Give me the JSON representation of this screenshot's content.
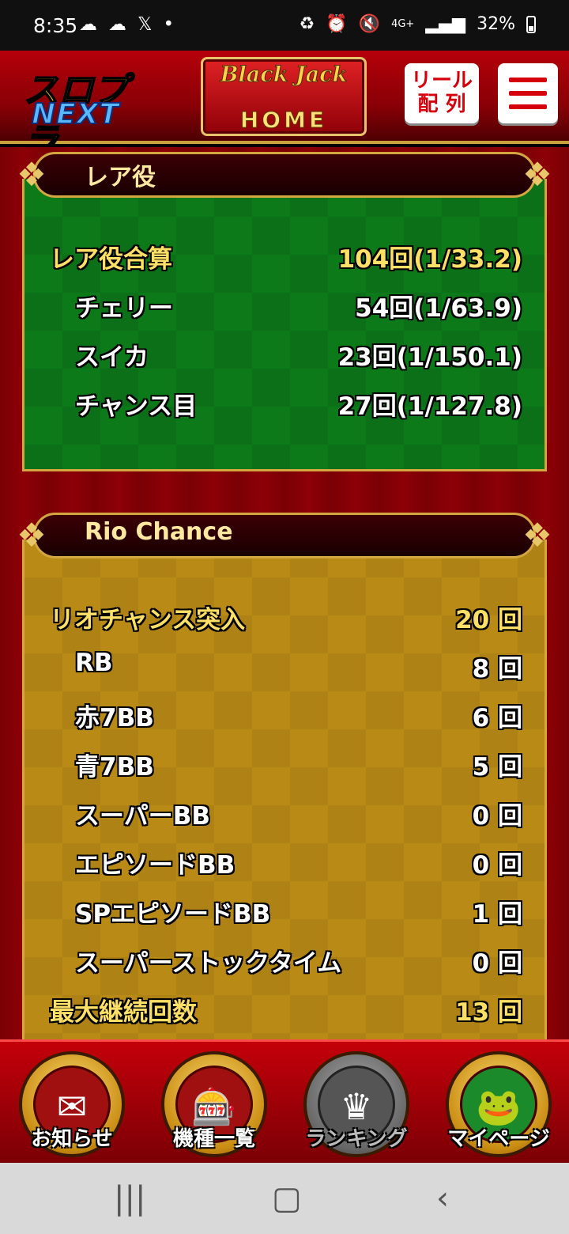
{
  "status_bar": {
    "time": "8:35",
    "left_icons": [
      "cloud-sync-icon",
      "cloud-icon",
      "x-logo-icon",
      "dot-icon"
    ],
    "signal_label": "4G+",
    "battery": "32%"
  },
  "header": {
    "logo_line1": "スロプラ",
    "logo_line2": "NEXT",
    "home_logo": "Black Jack",
    "home_label": "HOME",
    "reel_label_1": "リール",
    "reel_label_2": "配 列"
  },
  "rare": {
    "title": "レア役",
    "rows": [
      {
        "label": "レア役合算",
        "value": "104回(1/33.2)"
      },
      {
        "label": "チェリー",
        "value": "54回(1/63.9)"
      },
      {
        "label": "スイカ",
        "value": "23回(1/150.1)"
      },
      {
        "label": "チャンス目",
        "value": "27回(1/127.8)"
      }
    ]
  },
  "rio": {
    "title": "Rio Chance",
    "rows": [
      {
        "label": "リオチャンス突入",
        "value": "20 回"
      },
      {
        "label": "RB",
        "value": "8 回"
      },
      {
        "label": "赤7BB",
        "value": "6 回"
      },
      {
        "label": "青7BB",
        "value": "5 回"
      },
      {
        "label": "スーパーBB",
        "value": "0 回"
      },
      {
        "label": "エピソードBB",
        "value": "0 回"
      },
      {
        "label": "SPエピソードBB",
        "value": "1 回"
      },
      {
        "label": "スーパーストックタイム",
        "value": "0 回"
      },
      {
        "label": "最大継続回数",
        "value": "13 回"
      }
    ]
  },
  "bottom_nav": [
    {
      "label": "お知らせ",
      "icon": "letter-icon"
    },
    {
      "label": "機種一覧",
      "icon": "slot-machine-icon"
    },
    {
      "label": "ランキング",
      "icon": "crown-icon"
    },
    {
      "label": "マイページ",
      "icon": "frog-icon"
    }
  ]
}
